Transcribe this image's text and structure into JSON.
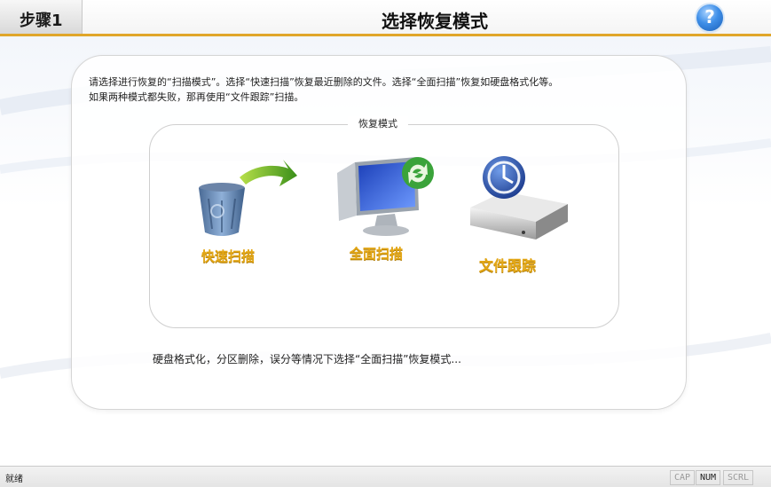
{
  "header": {
    "step": "步骤1",
    "title": "选择恢复模式",
    "help_icon": "?"
  },
  "intro": {
    "line1": "请选择进行恢复的“扫描模式”。选择“快速扫描”恢复最近删除的文件。选择“全面扫描”恢复如硬盘格式化等。",
    "line2": "如果两种模式都失败，那再使用“文件跟踪”扫描。"
  },
  "group": {
    "title": "恢复模式"
  },
  "modes": [
    {
      "label": "快速扫描",
      "icon": "recycle-bin-arrow-icon"
    },
    {
      "label": "全面扫描",
      "icon": "computer-refresh-icon"
    },
    {
      "label": "文件跟踪",
      "icon": "hard-drive-tracking-icon"
    }
  ],
  "hint": "硬盘格式化，分区删除，误分等情况下选择“全面扫描”恢复模式...",
  "statusbar": {
    "status": "就绪",
    "cap": "CAP",
    "num": "NUM",
    "scrl": "SCRL"
  },
  "colors": {
    "accent": "#e0a62a",
    "mode_label": "#e4a817",
    "help": "#3f8fe8"
  }
}
